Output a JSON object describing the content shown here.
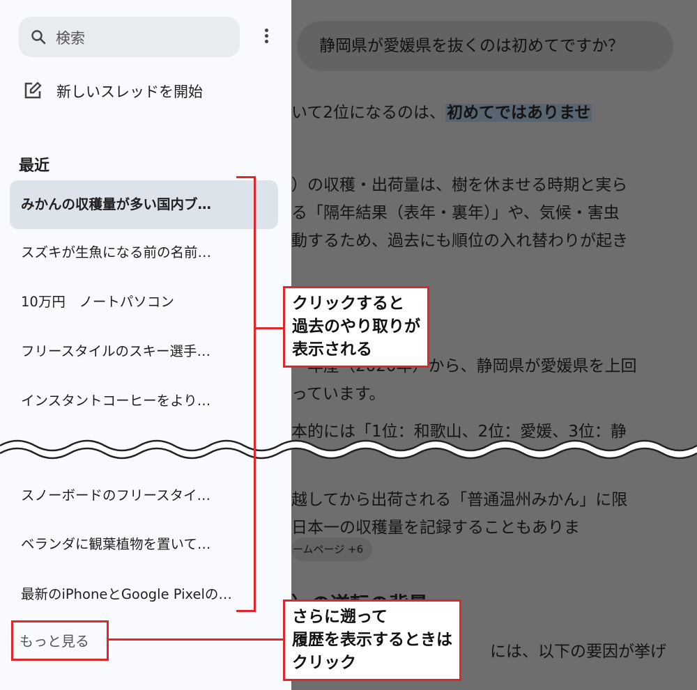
{
  "sidebar": {
    "search": {
      "placeholder": "検索",
      "icon": "search-icon"
    },
    "menu_icon": "more-vert-icon",
    "new_thread": {
      "icon": "edit-icon",
      "label": "新しいスレッドを開始"
    },
    "recent_title": "最近",
    "items": [
      {
        "label": "みかんの収穫量が多い国内ブ…",
        "active": true
      },
      {
        "label": "スズキが生魚になる前の名前…"
      },
      {
        "label": "10万円　ノートパソコン"
      },
      {
        "label": "フリースタイルのスキー選手…"
      },
      {
        "label": "インスタントコーヒーをより…"
      },
      {
        "label": "スノーボードのフリースタイ…"
      },
      {
        "label": "ベランダに観葉植物を置いて…"
      },
      {
        "label": "最新のiPhoneとGoogle Pixelの…"
      }
    ],
    "more_label": "もっと見る"
  },
  "chat": {
    "question": "静岡県が愛媛県を抜くのは初めてですか？",
    "line1_a": "いて2位になるのは、",
    "line1_hl": "初めてではありませ",
    "para2": [
      "）の収穫・出荷量は、樹を休ませる時期と実ら",
      "る「隔年結果（表年・裏年）」や、気候・害虫",
      "動するため、過去にも順位の入れ替わりが起き"
    ],
    "para3": [
      "〜年産（2020年）から、静岡県が愛媛県を上回",
      "っています。"
    ],
    "para4": "本的には「1位：和歌山、2位：愛媛、3位：静",
    "para5": [
      "越してから出荷される「普通温州みかん」に限",
      "日本一の収穫量を記録することもありま"
    ],
    "source_chip": "ームページ +6",
    "heading": "）の逆転の背景",
    "last_line": "には、以下の要因が挙げ"
  },
  "annotations": {
    "callout1": [
      "クリックすると",
      "過去のやり取りが",
      "表示される"
    ],
    "callout2": [
      "さらに遡って",
      "履歴を表示するときは",
      "クリック"
    ]
  },
  "colors": {
    "accent": "#e0262b",
    "overlay": "#6e6e6e",
    "active_item": "#dde3ea"
  }
}
